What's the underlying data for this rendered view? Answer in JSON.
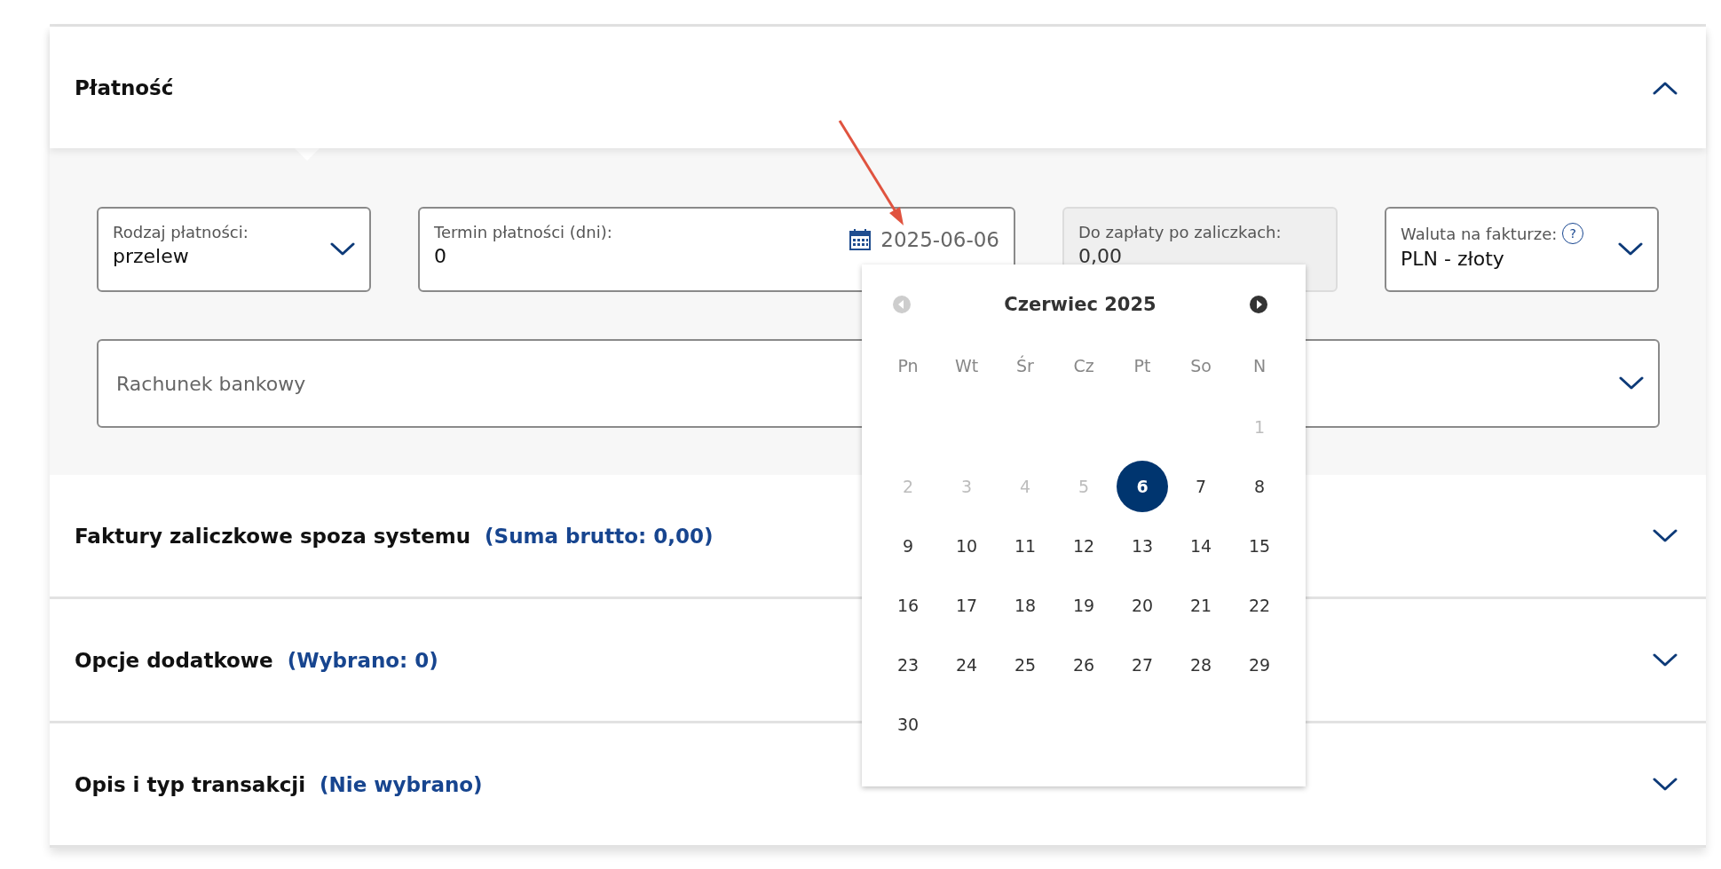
{
  "sections": [
    {
      "title": "Płatność",
      "expanded": true,
      "fields": [
        {
          "kind": "select",
          "label": "Rodzaj płatności:",
          "value": "przelew"
        },
        {
          "kind": "term",
          "label": "Termin płatności (dni):",
          "value": "0",
          "date": "2025-06-06"
        },
        {
          "kind": "readonly",
          "label": "Do zapłaty po zaliczkach:",
          "value": "0,00"
        },
        {
          "kind": "select",
          "label": "Waluta na fakturze:",
          "help_icon": "?",
          "value": "PLN - złoty"
        }
      ],
      "bank_account": {
        "placeholder": "Rachunek bankowy"
      }
    },
    {
      "title": "Faktury zaliczkowe spoza systemu",
      "summary": "(Suma brutto: 0,00)",
      "expanded": false
    },
    {
      "title": "Opcje dodatkowe",
      "summary": "(Wybrano: 0)",
      "expanded": false
    },
    {
      "title": "Opis i typ transakcji",
      "summary": "(Nie wybrano)",
      "expanded": false
    }
  ],
  "date_picker": {
    "month": "Czerwiec 2025",
    "prev_disabled": true,
    "next_disabled": false,
    "weekdays": [
      "Pn",
      "Wt",
      "Śr",
      "Cz",
      "Pt",
      "So",
      "N"
    ],
    "weeks": [
      {
        "days": [
          {
            "day": "1",
            "disabled": true,
            "selected": false
          }
        ]
      },
      {
        "days": [
          {
            "day": "2",
            "disabled": true,
            "selected": false
          },
          {
            "day": "3",
            "disabled": true,
            "selected": false
          },
          {
            "day": "4",
            "disabled": true,
            "selected": false
          },
          {
            "day": "5",
            "disabled": true,
            "selected": false
          },
          {
            "day": "6",
            "disabled": false,
            "selected": true
          },
          {
            "day": "7",
            "disabled": false,
            "selected": false
          },
          {
            "day": "8",
            "disabled": false,
            "selected": false
          }
        ]
      },
      {
        "days": [
          {
            "day": "9",
            "disabled": false,
            "selected": false
          },
          {
            "day": "10",
            "disabled": false,
            "selected": false
          },
          {
            "day": "11",
            "disabled": false,
            "selected": false
          },
          {
            "day": "12",
            "disabled": false,
            "selected": false
          },
          {
            "day": "13",
            "disabled": false,
            "selected": false
          },
          {
            "day": "14",
            "disabled": false,
            "selected": false
          },
          {
            "day": "15",
            "disabled": false,
            "selected": false
          }
        ]
      },
      {
        "days": [
          {
            "day": "16",
            "disabled": false,
            "selected": false
          },
          {
            "day": "17",
            "disabled": false,
            "selected": false
          },
          {
            "day": "18",
            "disabled": false,
            "selected": false
          },
          {
            "day": "19",
            "disabled": false,
            "selected": false
          },
          {
            "day": "20",
            "disabled": false,
            "selected": false
          },
          {
            "day": "21",
            "disabled": false,
            "selected": false
          },
          {
            "day": "22",
            "disabled": false,
            "selected": false
          }
        ]
      },
      {
        "days": [
          {
            "day": "23",
            "disabled": false,
            "selected": false
          },
          {
            "day": "24",
            "disabled": false,
            "selected": false
          },
          {
            "day": "25",
            "disabled": false,
            "selected": false
          },
          {
            "day": "26",
            "disabled": false,
            "selected": false
          },
          {
            "day": "27",
            "disabled": false,
            "selected": false
          },
          {
            "day": "28",
            "disabled": false,
            "selected": false
          },
          {
            "day": "29",
            "disabled": false,
            "selected": false
          }
        ]
      },
      {
        "days": [
          {
            "day": "30",
            "disabled": false,
            "selected": false
          }
        ]
      }
    ]
  }
}
